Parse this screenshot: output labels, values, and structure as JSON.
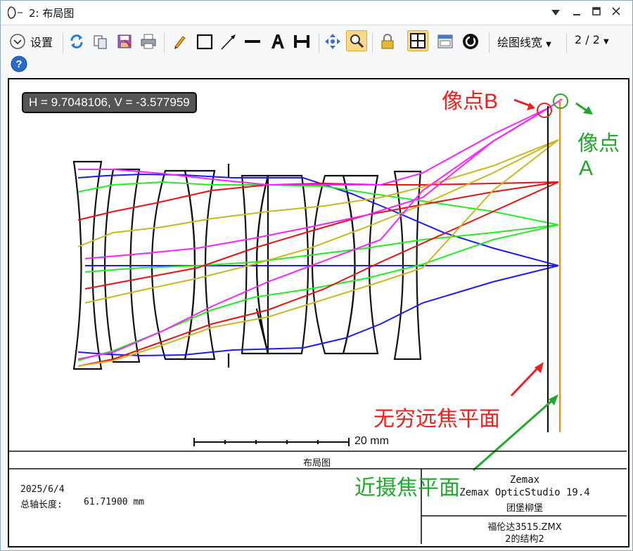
{
  "window": {
    "title": "2: 布局图"
  },
  "toolbar": {
    "settings_label": "设置",
    "linewidth_label": "绘图线宽",
    "page_label": "2 / 2"
  },
  "plot": {
    "coord_readout": "H = 9.7048106, V = -3.577959",
    "scale_label": "20 mm",
    "annotations": {
      "image_point_b": "像点B",
      "image_point_a_line1": "像点",
      "image_point_a_line2": "A",
      "infinity_focus_plane": "无穷远焦平面",
      "close_focus_plane": "近摄焦平面"
    }
  },
  "footer": {
    "caption": "布局图",
    "date": "2025/6/4",
    "total_length_label": "总轴长度:",
    "total_length_value": "61.71900 mm",
    "brand": "Zemax",
    "product": "Zemax OpticStudio 19.4",
    "org": "团堡柳堡",
    "filename": "福伦达3515.ZMX",
    "config": "2的结构2"
  },
  "colors": {
    "ray_blue": "#1a1aff",
    "ray_green": "#22ee22",
    "ray_red": "#ee1111",
    "ray_olive": "#c8b820",
    "ray_magenta": "#ff22ff",
    "close_focus_plane": "#f08a10",
    "annotation_red": "#ee2020",
    "annotation_green": "#22a82c",
    "active_tool": "#fbd78a"
  },
  "icons": [
    "window-lens-icon",
    "minimize-dropdown-icon",
    "minimize-icon",
    "maximize-icon",
    "close-icon",
    "chevron-down-icon",
    "refresh-icon",
    "copy-icon",
    "save-icon",
    "print-icon",
    "pencil-icon",
    "rectangle-icon",
    "arrow-icon",
    "line-icon",
    "text-icon",
    "dimension-icon",
    "move-icon",
    "zoom-icon",
    "lock-icon",
    "grid-icon",
    "window-icon",
    "power-icon",
    "help-icon"
  ]
}
